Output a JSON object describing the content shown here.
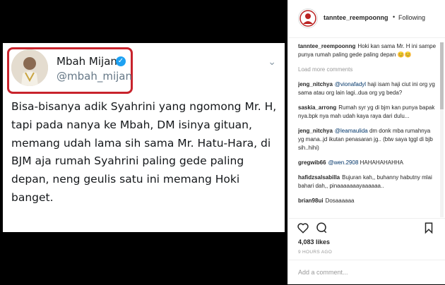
{
  "tweet": {
    "name": "Mbah Mijan",
    "handle": "@mbah_mijan",
    "text": "Bisa-bisanya adik Syahrini yang ngomong Mr. H, tapi pada nanya ke Mbah, DM isinya gituan, memang udah lama sih sama Mr. Hatu-Hara, di BJM aja rumah Syahrini paling gede paling depan, neng geulis satu ini memang Hoki banget.",
    "colors": {
      "highlight_box": "#c8232c",
      "verified": "#1da1f2"
    }
  },
  "post": {
    "username": "tanntee_reempoonng",
    "follow_separator": "•",
    "follow_label": "Following",
    "caption_user": "tanntee_reempoonng",
    "caption_text": "Hoki kan sama Mr. H ini sampe punya rumah paling gede paling depan 😊😊",
    "load_more": "Load more comments",
    "comments": [
      {
        "user": "jeng_nitchya",
        "mention": "@vionafadyl",
        "text": " haji isam haji ciut ini org yg sama atau org lain lagi..dua org yg beda?"
      },
      {
        "user": "saskia_arrong",
        "mention": "",
        "text": "Rumah syr yg di bjm kan punya bapak nya.bpk nya mah udah kaya raya dari dulu..."
      },
      {
        "user": "jeng_nitchya",
        "mention": "@leamaulida",
        "text": " dm donk mba rumahnya yg mana..jd ikutan penasaran jg.. (btw saya tggl di bjb sih..hihi)"
      },
      {
        "user": "gregwib66",
        "mention": "@wen.2908",
        "text": " HAHAHAHAHHA"
      },
      {
        "user": "hafidzsalsabilla",
        "mention": "",
        "text": "Bujuran kah,, buhanny habutny mlai bahari dah,, pinaaaaaaayaaaaaa.."
      },
      {
        "user": "brian98ui",
        "mention": "",
        "text": "Dosaaaaaa"
      }
    ],
    "likes": "4,083 likes",
    "time": "9 HOURS AGO",
    "add_comment_placeholder": "Add a comment..."
  },
  "icons": [
    "heart-icon",
    "comment-icon",
    "bookmark-icon",
    "verified-badge-icon",
    "chevron-down-icon"
  ]
}
